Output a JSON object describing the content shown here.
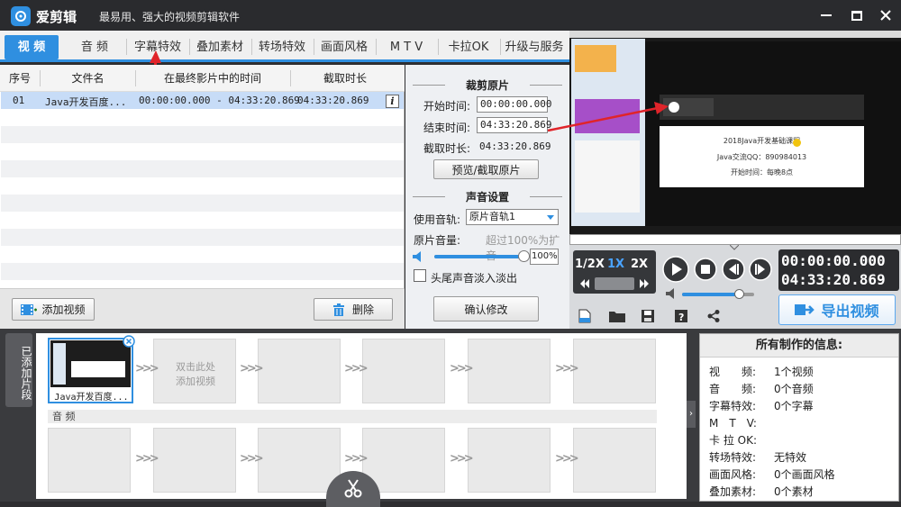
{
  "titlebar": {
    "app_name": "爱剪辑",
    "subtitle": "最易用、强大的视频剪辑软件"
  },
  "tabs": [
    "视 频",
    "音 频",
    "字幕特效",
    "叠加素材",
    "转场特效",
    "画面风格",
    "M T V",
    "卡拉OK",
    "升级与服务"
  ],
  "clip_list": {
    "columns": [
      "序号",
      "文件名",
      "在最终影片中的时间",
      "截取时长"
    ],
    "rows": [
      {
        "index": "01",
        "filename": "Java开发百度...",
        "timeline": "00:00:00.000 - 04:33:20.869",
        "duration": "04:33:20.869"
      }
    ],
    "add_button": "添加视频",
    "delete_button": "删除"
  },
  "trim": {
    "title": "裁剪原片",
    "start_label": "开始时间:",
    "start_value": "00:00:00.000",
    "end_label": "结束时间:",
    "end_value": "04:33:20.869",
    "duration_label": "截取时长:",
    "duration_value": "04:33:20.869",
    "preview_button": "预览/截取原片"
  },
  "audio": {
    "title": "声音设置",
    "track_label": "使用音轨:",
    "track_value": "原片音轨1",
    "volume_label": "原片音量:",
    "volume_hint": "超过100%为扩音",
    "volume_value": "100%",
    "volume_level": 1.0,
    "fade_label": "头尾声音淡入淡出",
    "confirm_button": "确认修改"
  },
  "player": {
    "speeds": [
      "1/2X",
      "1X",
      "2X"
    ],
    "active_speed": "1X",
    "time_current": "00:00:00.000",
    "time_total": "04:33:20.869",
    "export_button": "导出视频",
    "volume_level": 0.8
  },
  "preview_text": {
    "slide_line1": "2018Java开发基础课程",
    "slide_line2": "Java交流QQ：890984013",
    "slide_line3": "开始时间：每晚8点"
  },
  "timeline": {
    "added_label": "已添加片段",
    "first_clip_label": "Java开发百度...",
    "empty_clip_hint": "双击此处\n添加视频",
    "audio_label": "音 频"
  },
  "info": {
    "title": "所有制作的信息:",
    "rows": [
      {
        "key": "视　　频:",
        "value": "1个视频"
      },
      {
        "key": "音　　频:",
        "value": "0个音频"
      },
      {
        "key": "字幕特效:",
        "value": "0个字幕"
      },
      {
        "key": "M　T　V:",
        "value": ""
      },
      {
        "key": "卡 拉 OK:",
        "value": ""
      },
      {
        "key": "转场特效:",
        "value": "无特效"
      },
      {
        "key": "画面风格:",
        "value": "0个画面风格"
      },
      {
        "key": "叠加素材:",
        "value": "0个素材"
      }
    ]
  },
  "colors": {
    "accent": "#2f8fe0",
    "arrow": "#e0242a",
    "titlebar": "#2a2b2e"
  }
}
